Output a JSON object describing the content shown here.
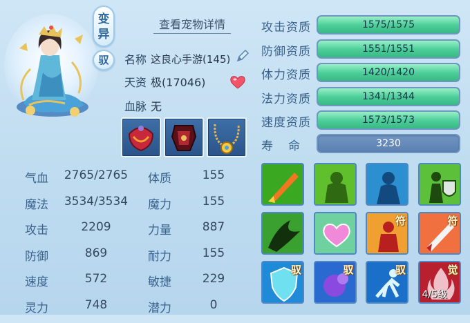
{
  "header": {
    "mutation_badge": "变异",
    "tamed_badge": "驭",
    "detail_button": "查看宠物详情"
  },
  "info": {
    "name_label": "名称",
    "name_value": "这良心手游(145)",
    "aptitude_label": "天资",
    "aptitude_value": "极(17046)",
    "bloodline_label": "血脉",
    "bloodline_value": "无"
  },
  "stats": [
    {
      "l1": "气血",
      "v1": "2765/2765",
      "l2": "体质",
      "v2": "155"
    },
    {
      "l1": "魔法",
      "v1": "3534/3534",
      "l2": "魔力",
      "v2": "155"
    },
    {
      "l1": "攻击",
      "v1": "2209",
      "l2": "力量",
      "v2": "887"
    },
    {
      "l1": "防御",
      "v1": "869",
      "l2": "耐力",
      "v2": "155"
    },
    {
      "l1": "速度",
      "v1": "572",
      "l2": "敏捷",
      "v2": "229"
    },
    {
      "l1": "灵力",
      "v1": "748",
      "l2": "潜力",
      "v2": "0"
    }
  ],
  "qualities": [
    {
      "label": "攻击资质",
      "text": "1575/1575",
      "fill": 1.0
    },
    {
      "label": "防御资质",
      "text": "1551/1551",
      "fill": 1.0
    },
    {
      "label": "体力资质",
      "text": "1420/1420",
      "fill": 1.0
    },
    {
      "label": "法力资质",
      "text": "1341/1344",
      "fill": 0.998
    },
    {
      "label": "速度资质",
      "text": "1573/1573",
      "fill": 1.0
    }
  ],
  "life": {
    "label": "寿命",
    "value": "3230"
  },
  "skills": [
    {
      "icon": "flaming-sword-icon",
      "tag": "",
      "level": ""
    },
    {
      "icon": "stone-body-icon",
      "tag": "",
      "level": ""
    },
    {
      "icon": "shadow-figure-icon",
      "tag": "",
      "level": ""
    },
    {
      "icon": "warrior-shield-icon",
      "tag": "",
      "level": ""
    },
    {
      "icon": "dark-claw-icon",
      "tag": "",
      "level": ""
    },
    {
      "icon": "heart-icon",
      "tag": "",
      "level": ""
    },
    {
      "icon": "red-figure-icon",
      "tag": "符",
      "level": ""
    },
    {
      "icon": "blade-icon",
      "tag": "符",
      "level": ""
    },
    {
      "icon": "shield-icon",
      "tag": "驭",
      "level": ""
    },
    {
      "icon": "purple-fist-icon",
      "tag": "驭",
      "level": ""
    },
    {
      "icon": "runner-icon",
      "tag": "驭",
      "level": ""
    },
    {
      "icon": "awaken-flame-icon",
      "tag": "觉",
      "level": "4/5级"
    }
  ],
  "colors": {
    "bar_fill": "#4fd09a",
    "bar_track": "#4c7aa8",
    "label": "#3a628c",
    "heart": "#f0556a"
  }
}
